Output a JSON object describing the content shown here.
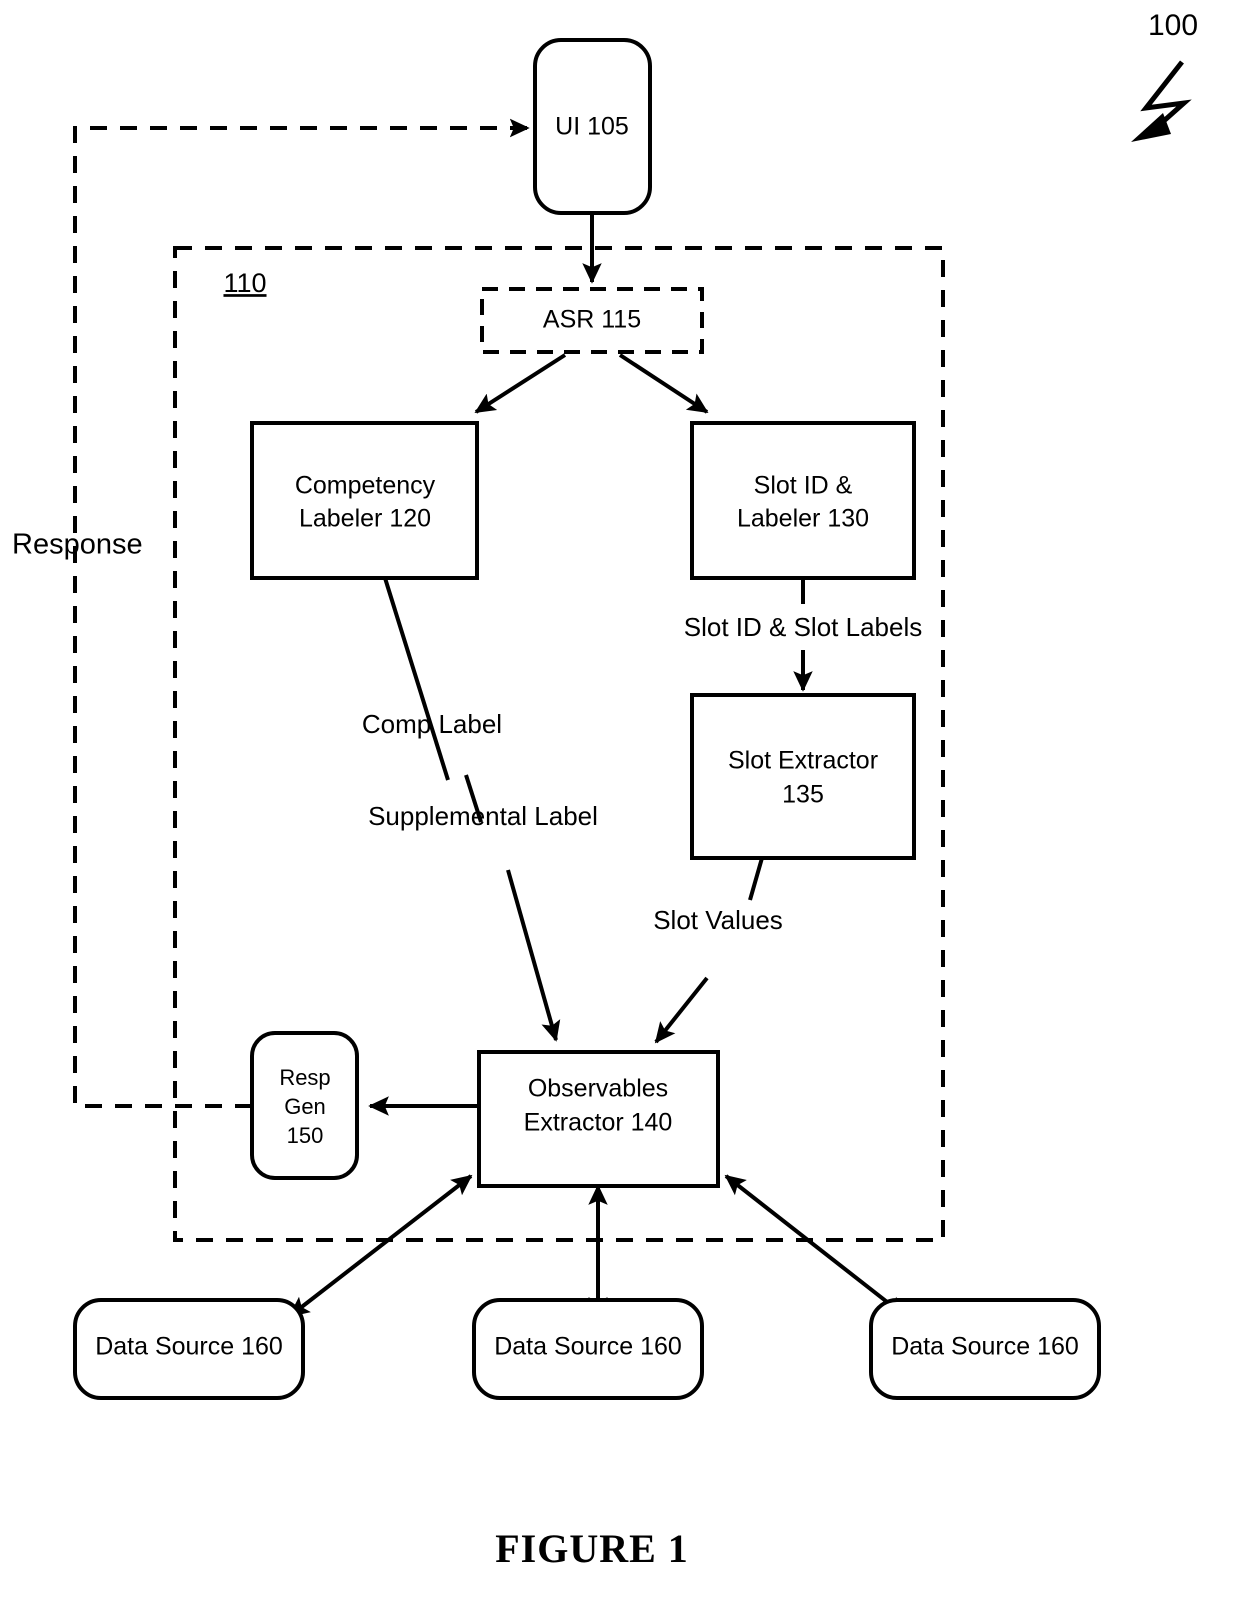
{
  "figure": {
    "caption": "FIGURE 1",
    "system_numeral": "100",
    "container_numeral": "110"
  },
  "nodes": {
    "ui": {
      "label": "UI 105",
      "shape": "rounded-rect",
      "border": "solid"
    },
    "asr": {
      "label": "ASR 115",
      "shape": "rect",
      "border": "dashed"
    },
    "competency_labeler": {
      "line1": "Competency",
      "line2": "Labeler 120",
      "shape": "rect",
      "border": "solid"
    },
    "slot_id_labeler": {
      "line1": "Slot ID &",
      "line2": "Labeler 130",
      "shape": "rect",
      "border": "solid"
    },
    "slot_extractor": {
      "line1": "Slot Extractor",
      "line2": "135",
      "shape": "rect",
      "border": "solid"
    },
    "observables_extractor": {
      "line1": "Observables",
      "line2": "Extractor 140",
      "shape": "rect",
      "border": "solid"
    },
    "resp_gen": {
      "line1": "Resp",
      "line2": "Gen",
      "line3": "150",
      "shape": "rounded-rect",
      "border": "solid"
    },
    "data_source_left": {
      "label": "Data Source 160",
      "shape": "rounded-rect",
      "border": "solid"
    },
    "data_source_center": {
      "label": "Data Source 160",
      "shape": "rounded-rect",
      "border": "solid"
    },
    "data_source_right": {
      "label": "Data Source 160",
      "shape": "rounded-rect",
      "border": "solid"
    }
  },
  "edge_labels": {
    "slot_id_slot_labels": "Slot ID & Slot Labels",
    "comp_label": "Comp Label",
    "supplemental_label": "Supplemental Label",
    "slot_values": "Slot Values",
    "response": "Response"
  },
  "colors": {
    "stroke": "#000000",
    "fill": "#ffffff",
    "background": "#ffffff"
  }
}
